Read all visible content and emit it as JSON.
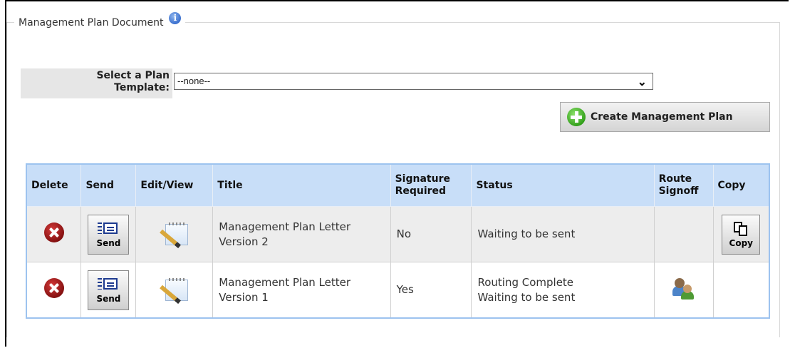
{
  "panel": {
    "legend": "Management Plan Document",
    "info_icon": "info-icon"
  },
  "template": {
    "label_line1": "Select a Plan",
    "label_line2": "Template:",
    "selected": "--none--"
  },
  "create_button": {
    "label": "Create Management Plan",
    "icon": "plus-circle-icon"
  },
  "table": {
    "headers": {
      "delete": "Delete",
      "send": "Send",
      "edit": "Edit/View",
      "title": "Title",
      "sig_line1": "Signature",
      "sig_line2": "Required",
      "status": "Status",
      "route_line1": "Route",
      "route_line2": "Signoff",
      "copy": "Copy"
    },
    "rows": [
      {
        "title_line1": "Management Plan Letter",
        "title_line2": "Version 2",
        "signature": "No",
        "status_line1": "Waiting to be sent",
        "status_line2": "",
        "send_label": "Send",
        "copy_label": "Copy",
        "has_route": false,
        "has_copy": true
      },
      {
        "title_line1": "Management Plan Letter",
        "title_line2": "Version 1",
        "signature": "Yes",
        "status_line1": "Routing Complete",
        "status_line2": "Waiting to be sent",
        "send_label": "Send",
        "copy_label": "",
        "has_route": true,
        "has_copy": false
      }
    ]
  },
  "colors": {
    "header_bg": "#c8def8",
    "table_border": "#9dc3ef",
    "delete_red": "#b01a1a",
    "create_green": "#2e9c17"
  }
}
